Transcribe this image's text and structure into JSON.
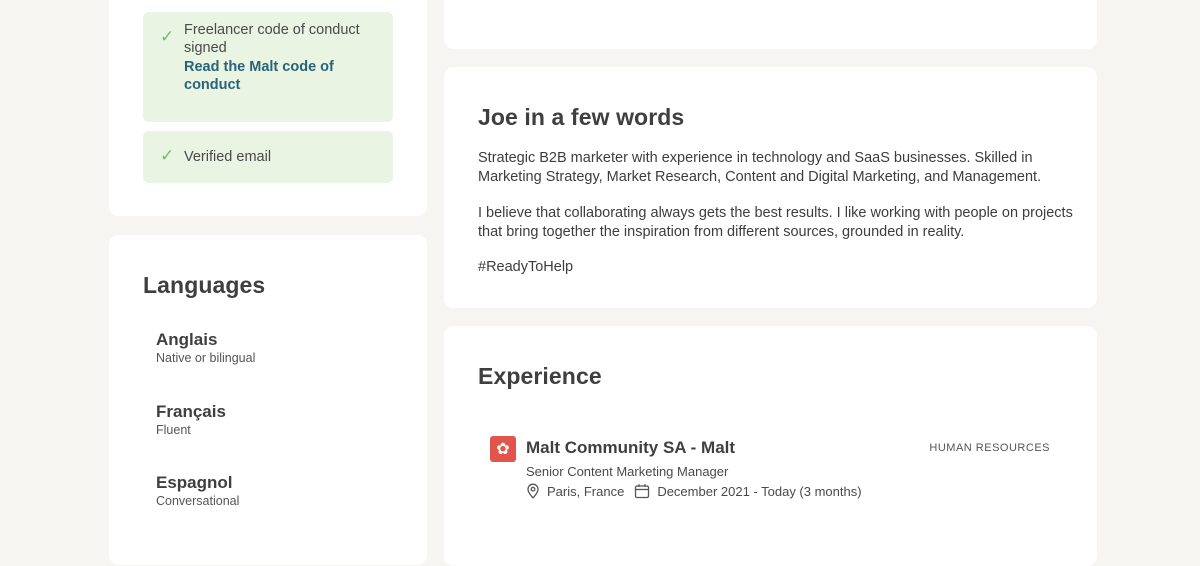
{
  "sidebar": {
    "badges": [
      {
        "text": "Freelancer code of conduct signed",
        "link": "Read the Malt code of conduct"
      },
      {
        "text": "Verified email"
      }
    ],
    "languages": {
      "title": "Languages",
      "items": [
        {
          "name": "Anglais",
          "level": "Native or bilingual"
        },
        {
          "name": "Français",
          "level": "Fluent"
        },
        {
          "name": "Espagnol",
          "level": "Conversational"
        }
      ]
    }
  },
  "about": {
    "title": "Joe in a few words",
    "paragraphs": [
      "Strategic B2B marketer with experience in technology and SaaS businesses. Skilled in Marketing Strategy, Market Research, Content and Digital Marketing, and Management.",
      "I believe that collaborating always gets the best results. I like working with people on projects that bring together the inspiration from different sources, grounded in reality.",
      "#ReadyToHelp"
    ]
  },
  "experience": {
    "title": "Experience",
    "items": [
      {
        "company": "Malt Community SA - Malt",
        "category": "HUMAN RESOURCES",
        "role": "Senior Content Marketing Manager",
        "location": "Paris, France",
        "dates": "December 2021 - Today (3 months)"
      }
    ]
  },
  "icons": {
    "check": "check-icon",
    "location": "location-pin-icon",
    "calendar": "calendar-icon",
    "company_logo": "malt-logo-icon"
  },
  "colors": {
    "badge_bg": "#e9f4e3",
    "check": "#6fbf6a",
    "link": "#2a6378",
    "logo": "#e2554b"
  }
}
